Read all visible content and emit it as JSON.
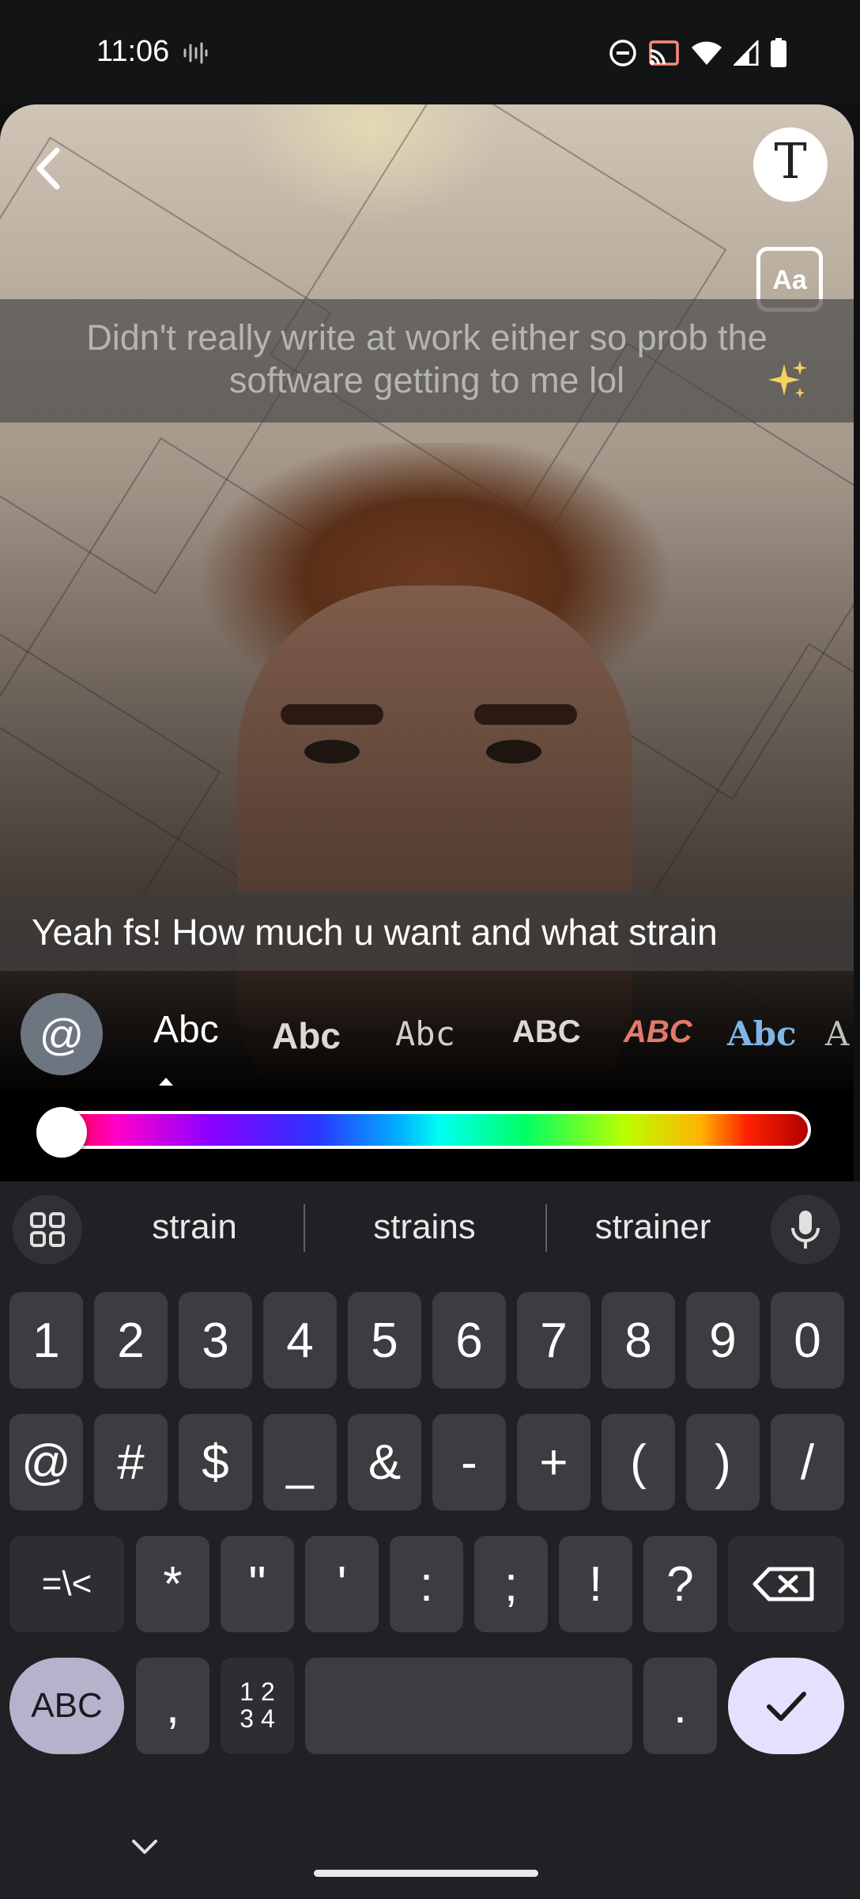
{
  "status_bar": {
    "time": "11:06",
    "icons": [
      "sound-wave-icon",
      "do-not-disturb-icon",
      "cast-icon",
      "wifi-icon",
      "cellular-signal-icon",
      "battery-icon"
    ]
  },
  "editor": {
    "caption_top": "Didn't really write at work either so prob the software getting to me lol",
    "caption_bottom": "Yeah fs! How much u want and what strain",
    "text_tool_label": "T",
    "text_style_label": "Aa",
    "mention_label": "@",
    "font_styles": [
      "Abc",
      "Abc",
      "Abc",
      "ABC",
      "ABC",
      "Abc",
      "A"
    ],
    "selected_font_index": 0,
    "text_color": "#ff0000",
    "color_slider_value": 0
  },
  "keyboard": {
    "suggestions": [
      "strain",
      "strains",
      "strainer"
    ],
    "row1": [
      "1",
      "2",
      "3",
      "4",
      "5",
      "6",
      "7",
      "8",
      "9",
      "0"
    ],
    "row2": [
      "@",
      "#",
      "$",
      "_",
      "&",
      "-",
      "+",
      "(",
      ")",
      "/"
    ],
    "row3": [
      "=\\<",
      "*",
      "\"",
      "'",
      ":",
      ";",
      "!",
      "?"
    ],
    "abc_label": "ABC",
    "comma": ",",
    "numpad_label_top": "1 2",
    "numpad_label_bottom": "3 4",
    "period": ".",
    "accent_color": "#e6e0ff"
  }
}
